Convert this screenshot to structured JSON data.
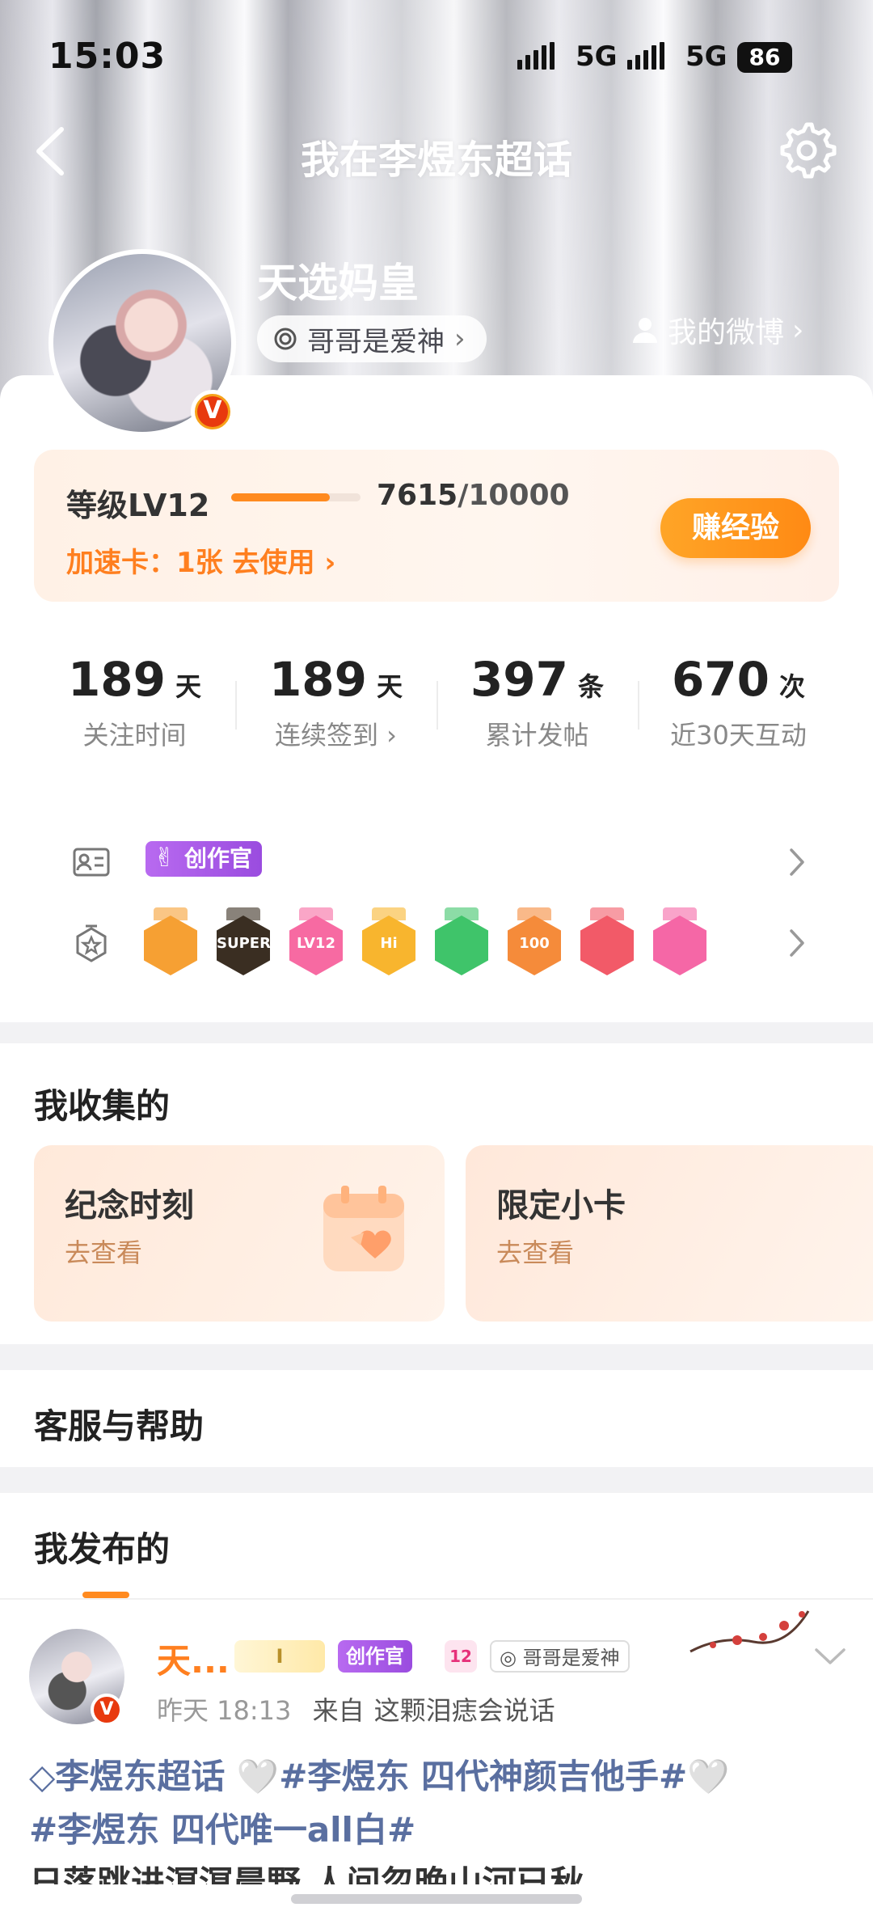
{
  "status": {
    "time": "15:03",
    "net1": "5G",
    "net2": "5G",
    "battery": "86"
  },
  "header": {
    "title": "我在李煜东超话"
  },
  "profile": {
    "name": "天选妈皇",
    "chip": "哥哥是爱神",
    "my_weibo": "我的微博",
    "verified": "V"
  },
  "level": {
    "label": "等级LV12",
    "progress": 0.7615,
    "current": "7615",
    "total": "/10000",
    "speed_card": "加速卡：1张 去使用 ›",
    "earn": "赚经验"
  },
  "stats": [
    {
      "value": "189",
      "unit": "天",
      "label": "关注时间"
    },
    {
      "value": "189",
      "unit": "天",
      "label": "连续签到 ›"
    },
    {
      "value": "397",
      "unit": "条",
      "label": "累计发帖"
    },
    {
      "value": "670",
      "unit": "次",
      "label": "近30天互动"
    }
  ],
  "badges": {
    "creator": "创作官",
    "medals": [
      {
        "icon": "crown-medal",
        "color": "#f6a033",
        "text": ""
      },
      {
        "icon": "super-medal",
        "color": "#3a2e22",
        "text": "SUPER"
      },
      {
        "icon": "lv12-medal",
        "color": "#f76aa2",
        "text": "LV12"
      },
      {
        "icon": "hi-medal",
        "color": "#f8b52e",
        "text": "Hi"
      },
      {
        "icon": "hand-medal",
        "color": "#3fc46a",
        "text": ""
      },
      {
        "icon": "100-days-medal",
        "color": "#f58b3a",
        "text": "100"
      },
      {
        "icon": "trophy-medal",
        "color": "#f25a68",
        "text": ""
      },
      {
        "icon": "cap-medal",
        "color": "#f567a6",
        "text": ""
      }
    ]
  },
  "collect": {
    "title": "我收集的",
    "cards": [
      {
        "title": "纪念时刻",
        "sub": "去查看"
      },
      {
        "title": "限定小卡",
        "sub": "去查看"
      }
    ]
  },
  "help": {
    "title": "客服与帮助"
  },
  "posts_section": {
    "title": "我发布的"
  },
  "post": {
    "name": "天...",
    "creator_tag": "创作官",
    "level_tag": "12",
    "chip_tag": "哥哥是爱神",
    "time": "昨天 18:13",
    "from_prefix": "来自",
    "source": "这颗泪痣会说话",
    "line1": "李煜东超话 🤍#李煜东 四代神颜吉他手#🤍",
    "line2": "#李煜东 四代唯一all白#",
    "line3": "日落跳进溟溟晨野 人间忽晚山河已秋"
  }
}
